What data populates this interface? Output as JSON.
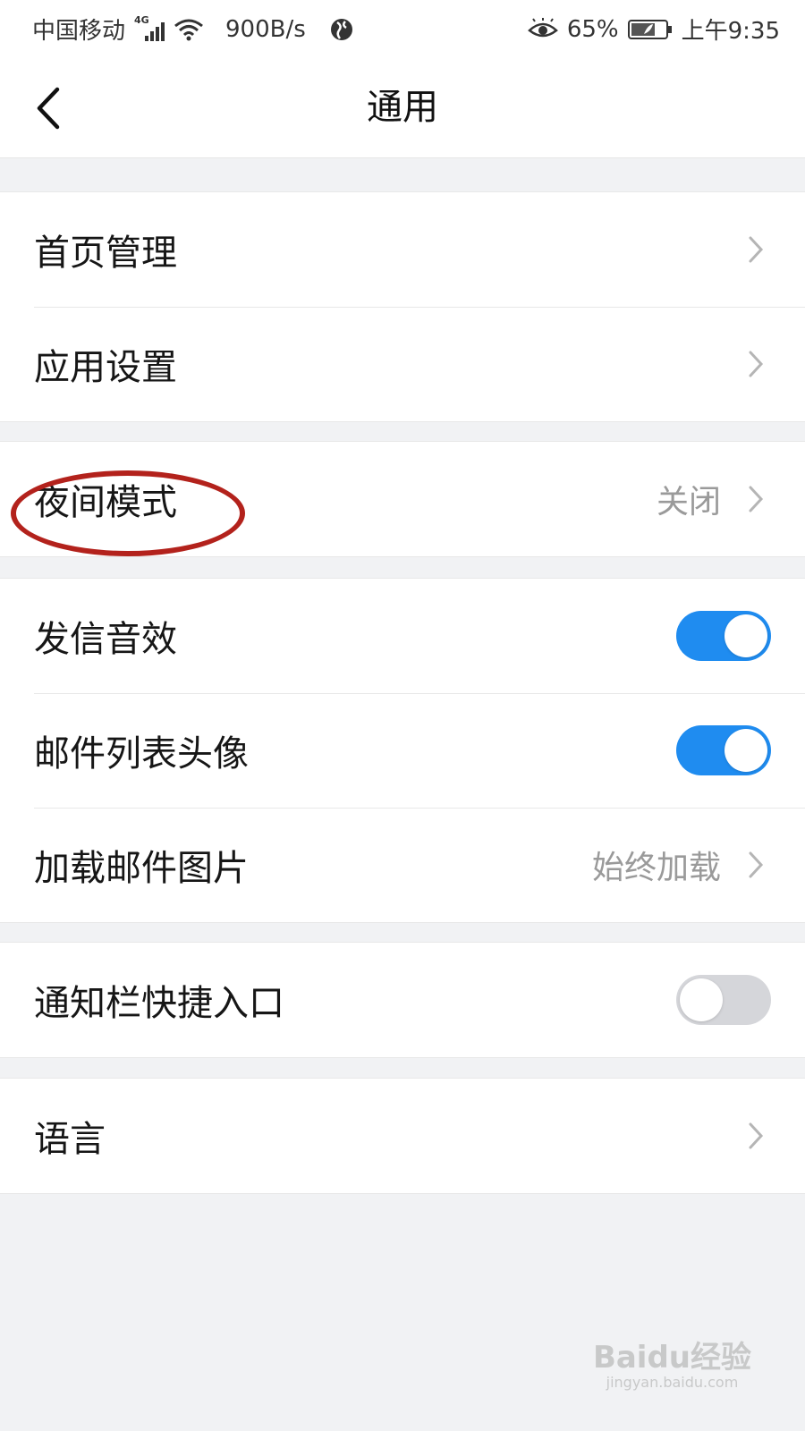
{
  "status_bar": {
    "carrier": "中国移动",
    "network_type": "4G",
    "speed": "900B/s",
    "battery": "65%",
    "time": "上午9:35"
  },
  "header": {
    "title": "通用"
  },
  "groups": [
    {
      "rows": [
        {
          "label": "首页管理",
          "type": "nav"
        },
        {
          "label": "应用设置",
          "type": "nav"
        }
      ]
    },
    {
      "rows": [
        {
          "label": "夜间模式",
          "value": "关闭",
          "type": "nav"
        }
      ]
    },
    {
      "rows": [
        {
          "label": "发信音效",
          "type": "toggle",
          "on": true
        },
        {
          "label": "邮件列表头像",
          "type": "toggle",
          "on": true
        },
        {
          "label": "加载邮件图片",
          "value": "始终加载",
          "type": "nav"
        }
      ]
    },
    {
      "rows": [
        {
          "label": "通知栏快捷入口",
          "type": "toggle",
          "on": false
        }
      ]
    },
    {
      "rows": [
        {
          "label": "语言",
          "type": "nav"
        }
      ]
    }
  ],
  "watermark": {
    "brand": "Baidu经验",
    "url": "jingyan.baidu.com"
  },
  "colors": {
    "toggle_on": "#1f8cf0",
    "toggle_off": "#d5d6da",
    "annotation": "#b3221c"
  }
}
